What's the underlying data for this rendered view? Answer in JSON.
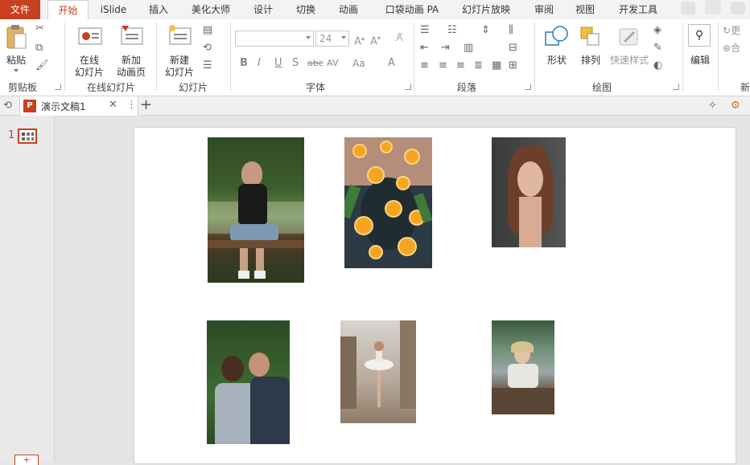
{
  "tabs": [
    {
      "label": "文件"
    },
    {
      "label": "开始"
    },
    {
      "label": "iSlide"
    },
    {
      "label": "插入"
    },
    {
      "label": "美化大师"
    },
    {
      "label": "设计"
    },
    {
      "label": "切换"
    },
    {
      "label": "动画"
    },
    {
      "label": "口袋动画 PA"
    },
    {
      "label": "幻灯片放映"
    },
    {
      "label": "审阅"
    },
    {
      "label": "视图"
    },
    {
      "label": "开发工具"
    }
  ],
  "ribbon": {
    "clipboard": {
      "paste": "粘贴",
      "group": "剪贴板"
    },
    "online": {
      "online_slide": "在线\n幻灯片",
      "new_anim_page": "新加\n动画页",
      "group": "在线幻灯片"
    },
    "slides": {
      "new_slide": "新建\n幻灯片",
      "group": "幻灯片"
    },
    "font": {
      "font_name": "",
      "font_size": "24",
      "group": "字体"
    },
    "paragraph": {
      "group": "段落"
    },
    "drawing": {
      "shape": "形状",
      "arrange": "排列",
      "quick_style": "快速样式",
      "group": "绘图"
    },
    "editing": {
      "edit": "编辑"
    },
    "new_group": {
      "group": "新",
      "more1": "更",
      "more2": "合"
    }
  },
  "document": {
    "tab_title": "演示文稿1"
  },
  "thumbnails": {
    "slide_number": "1"
  },
  "colors": {
    "accent": "#c8401f",
    "ribbon_bg": "#ffffff",
    "tabbar_bg": "#f3f3f3"
  }
}
